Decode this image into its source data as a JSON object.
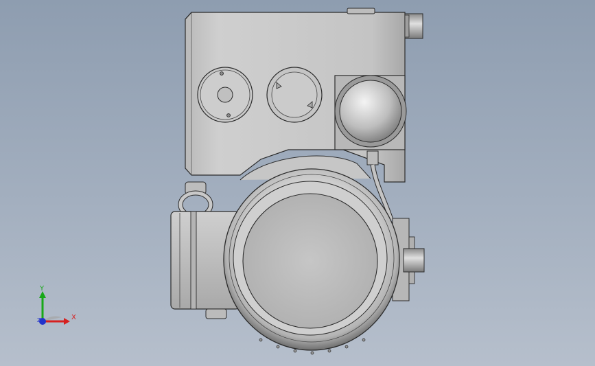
{
  "viewport": {
    "background_top": "#8e9db0",
    "background_bottom": "#b6bfcc"
  },
  "model": {
    "body_color": "#c9c9c9",
    "shade_color": "#9c9c9c",
    "edge_color": "#2b2b2b"
  },
  "triad": {
    "x_label": "X",
    "y_label": "Y",
    "z_label": "Z",
    "x_color": "#d62020",
    "y_color": "#18a818",
    "z_color": "#2233cc"
  }
}
